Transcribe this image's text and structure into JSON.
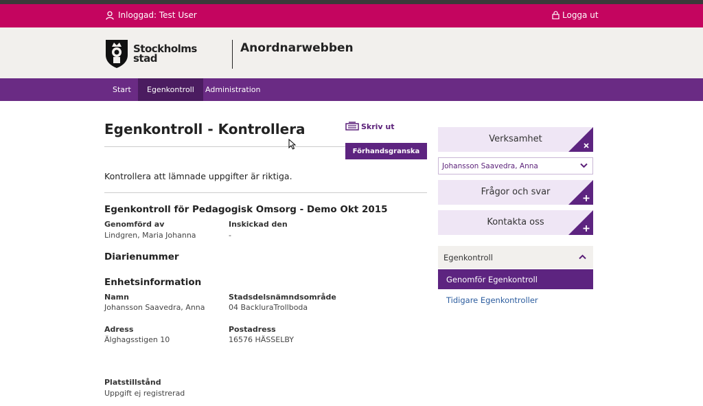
{
  "topbar": {
    "user_text": "Inloggad: Test User",
    "logout_label": "Logga ut",
    "color": "#c4055f"
  },
  "header": {
    "logo_line1": "Stockholms",
    "logo_line2": "stad",
    "app_name": "Anordnarwebben"
  },
  "nav": {
    "items": [
      {
        "label": "Start"
      },
      {
        "label": "Egenkontroll"
      },
      {
        "label": "Administration"
      }
    ],
    "active": "Egenkontroll",
    "color": "#6a2b84"
  },
  "main": {
    "title": "Egenkontroll - Kontrollera",
    "print_label": "Skriv ut",
    "preview_label": "Förhandsgranska",
    "intro": "Kontrollera att lämnade uppgifter är riktiga.",
    "report": {
      "heading": "Egenkontroll för Pedagogisk Omsorg - Demo Okt 2015",
      "performed_by_label": "Genomförd av",
      "performed_by_value": "Lindgren, Maria Johanna",
      "submitted_label": "Inskickad den",
      "submitted_value": "-"
    },
    "diary_heading": "Diarienummer",
    "unit": {
      "heading": "Enhetsinformation",
      "name_label": "Namn",
      "name_value": "Johansson Saavedra, Anna",
      "district_label": "Stadsdelsnämndsområde",
      "district_value": "04 BackluraTrollboda",
      "address_label": "Adress",
      "address_value": "Älghagsstigen 10",
      "postal_label": "Postadress",
      "postal_value": "16576 HÄSSELBY",
      "permit_label": "Platstillstånd",
      "permit_value": "Uppgift ej registrerad"
    }
  },
  "sidebar": {
    "business_label": "Verksamhet",
    "business_selected": "Johansson Saavedra, Anna",
    "faq_label": "Frågor och svar",
    "contact_label": "Kontakta oss",
    "accordion": {
      "title": "Egenkontroll",
      "active_item": "Genomför Egenkontroll",
      "link_item": "Tidigare Egenkontroller"
    },
    "icons": {
      "close": "close-icon",
      "plus": "plus-icon",
      "chevron_down": "chevron-down-icon",
      "chevron_up": "chevron-up-icon"
    }
  }
}
